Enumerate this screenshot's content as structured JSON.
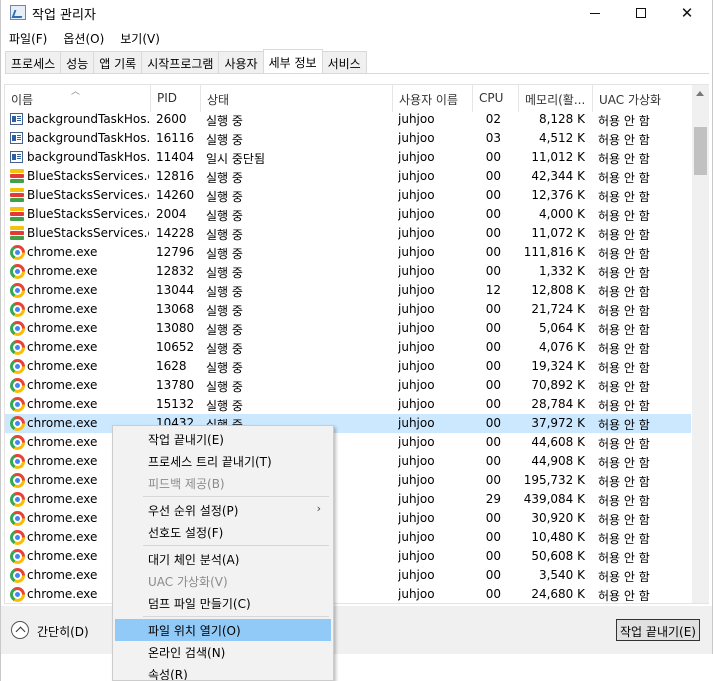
{
  "window": {
    "title": "작업 관리자"
  },
  "menubar": [
    "파일(F)",
    "옵션(O)",
    "보기(V)"
  ],
  "tabs": [
    {
      "label": "프로세스",
      "active": false
    },
    {
      "label": "성능",
      "active": false
    },
    {
      "label": "앱 기록",
      "active": false
    },
    {
      "label": "시작프로그램",
      "active": false
    },
    {
      "label": "사용자",
      "active": false
    },
    {
      "label": "세부 정보",
      "active": true
    },
    {
      "label": "서비스",
      "active": false
    }
  ],
  "columns": {
    "name": "이름",
    "pid": "PID",
    "status": "상태",
    "user": "사용자 이름",
    "cpu": "CPU",
    "memory": "메모리(활...",
    "uac": "UAC 가상화"
  },
  "rows": [
    {
      "icon": "task-host-icon",
      "name": "backgroundTaskHos...",
      "pid": "2600",
      "status": "실행 중",
      "user": "juhjoo",
      "cpu": "02",
      "mem": "8,128 K",
      "uac": "허용 안 함"
    },
    {
      "icon": "task-host-icon",
      "name": "backgroundTaskHos...",
      "pid": "16116",
      "status": "실행 중",
      "user": "juhjoo",
      "cpu": "03",
      "mem": "4,512 K",
      "uac": "허용 안 함"
    },
    {
      "icon": "task-host-icon",
      "name": "backgroundTaskHos...",
      "pid": "11404",
      "status": "일시 중단됨",
      "user": "juhjoo",
      "cpu": "00",
      "mem": "11,012 K",
      "uac": "허용 안 함"
    },
    {
      "icon": "bluestacks-icon",
      "name": "BlueStacksServices.e...",
      "pid": "12816",
      "status": "실행 중",
      "user": "juhjoo",
      "cpu": "00",
      "mem": "42,344 K",
      "uac": "허용 안 함"
    },
    {
      "icon": "bluestacks-icon",
      "name": "BlueStacksServices.e...",
      "pid": "14260",
      "status": "실행 중",
      "user": "juhjoo",
      "cpu": "00",
      "mem": "12,376 K",
      "uac": "허용 안 함"
    },
    {
      "icon": "bluestacks-icon",
      "name": "BlueStacksServices.e...",
      "pid": "2004",
      "status": "실행 중",
      "user": "juhjoo",
      "cpu": "00",
      "mem": "4,000 K",
      "uac": "허용 안 함"
    },
    {
      "icon": "bluestacks-icon",
      "name": "BlueStacksServices.e...",
      "pid": "14228",
      "status": "실행 중",
      "user": "juhjoo",
      "cpu": "00",
      "mem": "11,072 K",
      "uac": "허용 안 함"
    },
    {
      "icon": "chrome-icon",
      "name": "chrome.exe",
      "pid": "12796",
      "status": "실행 중",
      "user": "juhjoo",
      "cpu": "00",
      "mem": "111,816 K",
      "uac": "허용 안 함"
    },
    {
      "icon": "chrome-icon",
      "name": "chrome.exe",
      "pid": "12832",
      "status": "실행 중",
      "user": "juhjoo",
      "cpu": "00",
      "mem": "1,332 K",
      "uac": "허용 안 함"
    },
    {
      "icon": "chrome-icon",
      "name": "chrome.exe",
      "pid": "13044",
      "status": "실행 중",
      "user": "juhjoo",
      "cpu": "12",
      "mem": "12,808 K",
      "uac": "허용 안 함"
    },
    {
      "icon": "chrome-icon",
      "name": "chrome.exe",
      "pid": "13068",
      "status": "실행 중",
      "user": "juhjoo",
      "cpu": "00",
      "mem": "21,724 K",
      "uac": "허용 안 함"
    },
    {
      "icon": "chrome-icon",
      "name": "chrome.exe",
      "pid": "13080",
      "status": "실행 중",
      "user": "juhjoo",
      "cpu": "00",
      "mem": "5,064 K",
      "uac": "허용 안 함"
    },
    {
      "icon": "chrome-icon",
      "name": "chrome.exe",
      "pid": "10652",
      "status": "실행 중",
      "user": "juhjoo",
      "cpu": "00",
      "mem": "4,076 K",
      "uac": "허용 안 함"
    },
    {
      "icon": "chrome-icon",
      "name": "chrome.exe",
      "pid": "1628",
      "status": "실행 중",
      "user": "juhjoo",
      "cpu": "00",
      "mem": "19,324 K",
      "uac": "허용 안 함"
    },
    {
      "icon": "chrome-icon",
      "name": "chrome.exe",
      "pid": "13780",
      "status": "실행 중",
      "user": "juhjoo",
      "cpu": "00",
      "mem": "70,892 K",
      "uac": "허용 안 함"
    },
    {
      "icon": "chrome-icon",
      "name": "chrome.exe",
      "pid": "15132",
      "status": "실행 중",
      "user": "juhjoo",
      "cpu": "00",
      "mem": "28,784 K",
      "uac": "허용 안 함"
    },
    {
      "icon": "chrome-icon",
      "name": "chrome.exe",
      "pid": "10432",
      "status": "실행 중",
      "user": "juhjoo",
      "cpu": "00",
      "mem": "37,972 K",
      "uac": "허용 안 함",
      "selected": true
    },
    {
      "icon": "chrome-icon",
      "name": "chrome.exe",
      "pid": "",
      "status": "",
      "user": "juhjoo",
      "cpu": "00",
      "mem": "44,608 K",
      "uac": "허용 안 함"
    },
    {
      "icon": "chrome-icon",
      "name": "chrome.exe",
      "pid": "",
      "status": "",
      "user": "juhjoo",
      "cpu": "00",
      "mem": "44,908 K",
      "uac": "허용 안 함"
    },
    {
      "icon": "chrome-icon",
      "name": "chrome.exe",
      "pid": "",
      "status": "",
      "user": "juhjoo",
      "cpu": "00",
      "mem": "195,732 K",
      "uac": "허용 안 함"
    },
    {
      "icon": "chrome-icon",
      "name": "chrome.exe",
      "pid": "",
      "status": "",
      "user": "juhjoo",
      "cpu": "29",
      "mem": "439,084 K",
      "uac": "허용 안 함"
    },
    {
      "icon": "chrome-icon",
      "name": "chrome.exe",
      "pid": "",
      "status": "",
      "user": "juhjoo",
      "cpu": "00",
      "mem": "30,920 K",
      "uac": "허용 안 함"
    },
    {
      "icon": "chrome-icon",
      "name": "chrome.exe",
      "pid": "",
      "status": "",
      "user": "juhjoo",
      "cpu": "00",
      "mem": "10,480 K",
      "uac": "허용 안 함"
    },
    {
      "icon": "chrome-icon",
      "name": "chrome.exe",
      "pid": "",
      "status": "",
      "user": "juhjoo",
      "cpu": "00",
      "mem": "50,608 K",
      "uac": "허용 안 함"
    },
    {
      "icon": "chrome-icon",
      "name": "chrome.exe",
      "pid": "",
      "status": "",
      "user": "juhjoo",
      "cpu": "00",
      "mem": "3,540 K",
      "uac": "허용 안 함"
    },
    {
      "icon": "chrome-icon",
      "name": "chrome.exe",
      "pid": "",
      "status": "",
      "user": "juhjoo",
      "cpu": "00",
      "mem": "24,680 K",
      "uac": "허용 안 함"
    }
  ],
  "footer": {
    "collapse_label": "간단히(D)",
    "end_task_label": "작업 끝내기(E)"
  },
  "context_menu": [
    {
      "label": "작업 끝내기(E)",
      "disabled": false
    },
    {
      "label": "프로세스 트리 끝내기(T)",
      "disabled": false
    },
    {
      "label": "피드백 제공(B)",
      "disabled": true
    },
    {
      "sep": true
    },
    {
      "label": "우선 순위 설정(P)",
      "disabled": false,
      "submenu": true
    },
    {
      "label": "선호도 설정(F)",
      "disabled": false
    },
    {
      "sep": true
    },
    {
      "label": "대기 체인 분석(A)",
      "disabled": false
    },
    {
      "label": "UAC 가상화(V)",
      "disabled": true
    },
    {
      "label": "덤프 파일 만들기(C)",
      "disabled": false
    },
    {
      "sep": true
    },
    {
      "label": "파일 위치 열기(O)",
      "disabled": false,
      "highlighted": true
    },
    {
      "label": "온라인 검색(N)",
      "disabled": false
    },
    {
      "label": "속성(R)",
      "disabled": false
    }
  ]
}
